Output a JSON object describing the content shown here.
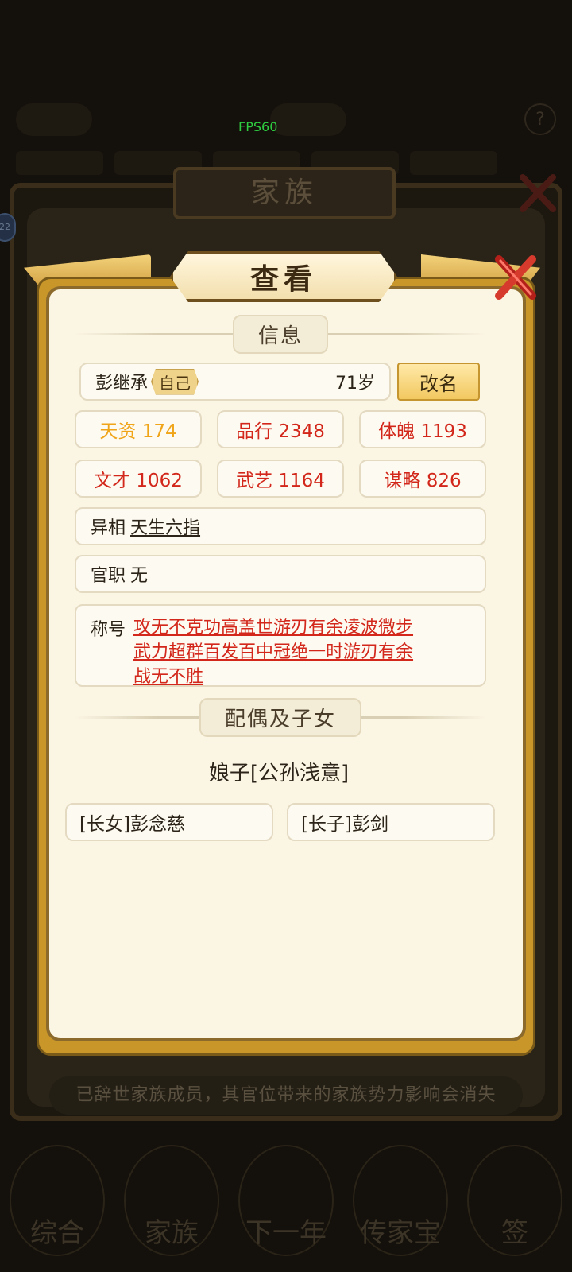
{
  "background": {
    "fps_label": "FPS60",
    "family_title": "家族",
    "footer_note": "已辞世家族成员，其官位带来的家族势力影响会消失",
    "bottom_nav": [
      "综合",
      "家族",
      "下一年",
      "传家宝",
      "签"
    ]
  },
  "modal": {
    "title": "查看",
    "info_section": "信息",
    "name": "彭继承",
    "self_tag": "自己",
    "age": "71岁",
    "rename_label": "改名",
    "stats": [
      {
        "label": "天资 174",
        "color": "#f0a418"
      },
      {
        "label": "品行 2348",
        "color": "#d2271a"
      },
      {
        "label": "体魄 1193",
        "color": "#d2271a"
      },
      {
        "label": "文才 1062",
        "color": "#d2271a"
      },
      {
        "label": "武艺 1164",
        "color": "#d2271a"
      },
      {
        "label": "谋略 826",
        "color": "#d2271a"
      }
    ],
    "feature_label": "异相",
    "feature_value": "天生六指",
    "office_label": "官职",
    "office_value": "无",
    "title_label": "称号",
    "titles_line1": "攻无不克功高盖世游刃有余凌波微步",
    "titles_line2": "武力超群百发百中冠绝一时游刃有余",
    "titles_line3": "战无不胜",
    "family_section": "配偶及子女",
    "spouse": "娘子[公孙浅意]",
    "children": [
      "[长女]彭念慈",
      "[长子]彭剑"
    ]
  }
}
